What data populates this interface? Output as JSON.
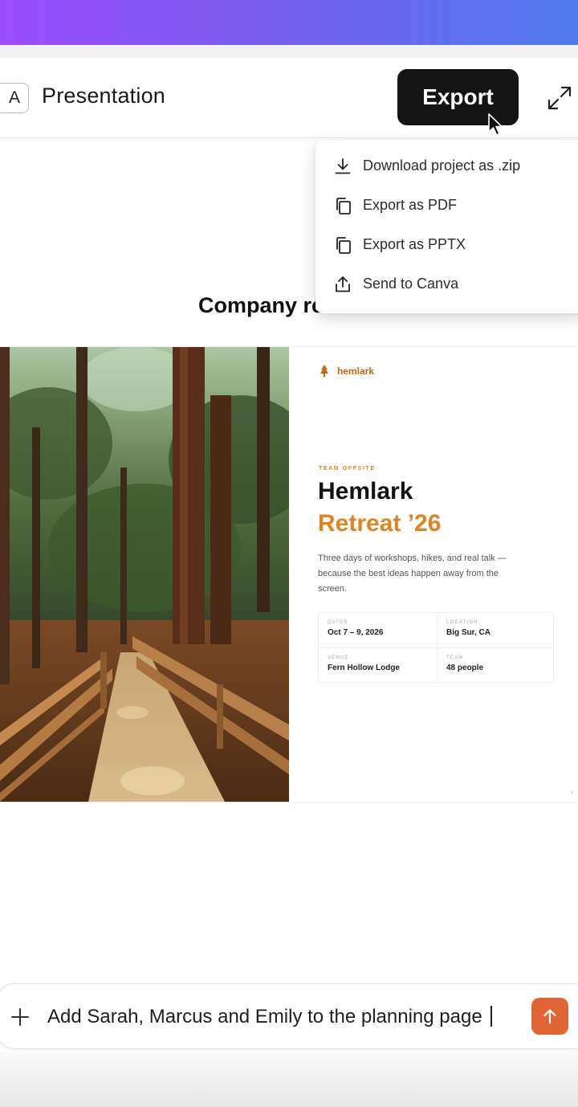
{
  "header": {
    "app_icon_letter": "A",
    "title": "Presentation",
    "export_label": "Export"
  },
  "export_menu": {
    "items": [
      {
        "label": "Download project as .zip",
        "icon": "download-icon"
      },
      {
        "label": "Export as PDF",
        "icon": "copy-icon"
      },
      {
        "label": "Export as PPTX",
        "icon": "copy-icon"
      },
      {
        "label": "Send to Canva",
        "icon": "share-upload-icon"
      }
    ]
  },
  "page": {
    "section_heading": "Company retreat"
  },
  "slide": {
    "brand": "hemlark",
    "eyebrow": "TEAM OFFSITE",
    "title_line1": "Hemlark",
    "title_line2": "Retreat ’26",
    "description": "Three days of workshops, hikes, and real talk — because the best ideas happen away from the screen.",
    "info": [
      {
        "label": "DATES",
        "value": "Oct 7 – 9, 2026"
      },
      {
        "label": "LOCATION",
        "value": "Big Sur, CA"
      },
      {
        "label": "VENUE",
        "value": "Fern Hollow Lodge"
      },
      {
        "label": "TEAM",
        "value": "48 people"
      }
    ],
    "page_number": "1",
    "colors": {
      "accent": "#dd8522",
      "brand": "#c26a10"
    }
  },
  "prompt": {
    "value": "Add Sarah, Marcus and Emily to the planning page",
    "send_color": "#e06535"
  }
}
